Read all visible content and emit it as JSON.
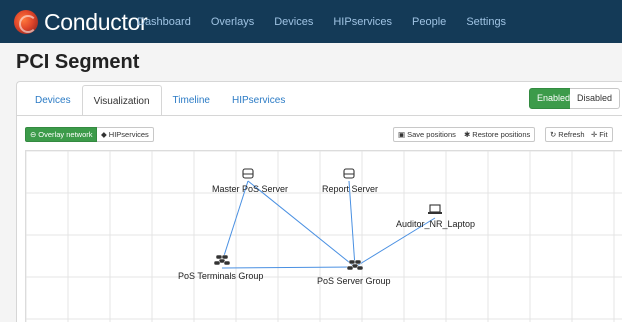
{
  "app": {
    "brand": "Conductor",
    "nav": [
      "Dashboard",
      "Overlays",
      "Devices",
      "HIPservices",
      "People",
      "Settings"
    ]
  },
  "page": {
    "title": "PCI Segment"
  },
  "tabs": [
    "Devices",
    "Visualization",
    "Timeline",
    "HIPservices"
  ],
  "active_tab": "Visualization",
  "status_toggle": {
    "enabled_label": "Enabled",
    "disabled_label": "Disabled",
    "selected": "Enabled"
  },
  "toolbar": {
    "overlay_network": "Overlay network",
    "hipservices": "HIPservices",
    "save_positions": "Save positions",
    "restore_positions": "Restore positions",
    "refresh": "Refresh",
    "fit": "Fit"
  },
  "graph": {
    "nodes": [
      {
        "id": "master",
        "label": "Master PoS Server",
        "icon": "server-icon"
      },
      {
        "id": "report",
        "label": "Report Server",
        "icon": "server-icon"
      },
      {
        "id": "laptop",
        "label": "Auditor_NR_Laptop",
        "icon": "laptop-icon"
      },
      {
        "id": "terminals",
        "label": "PoS Terminals Group",
        "icon": "group-icon"
      },
      {
        "id": "servergroup",
        "label": "PoS Server Group",
        "icon": "group-icon"
      }
    ],
    "edges": [
      [
        "master",
        "terminals"
      ],
      [
        "master",
        "servergroup"
      ],
      [
        "report",
        "servergroup"
      ],
      [
        "laptop",
        "servergroup"
      ],
      [
        "terminals",
        "servergroup"
      ]
    ]
  },
  "colors": {
    "navbar": "#143a57",
    "accent_green": "#3c9b4a",
    "link_blue": "#2b7bc5",
    "edge_blue": "#4a90e2"
  }
}
